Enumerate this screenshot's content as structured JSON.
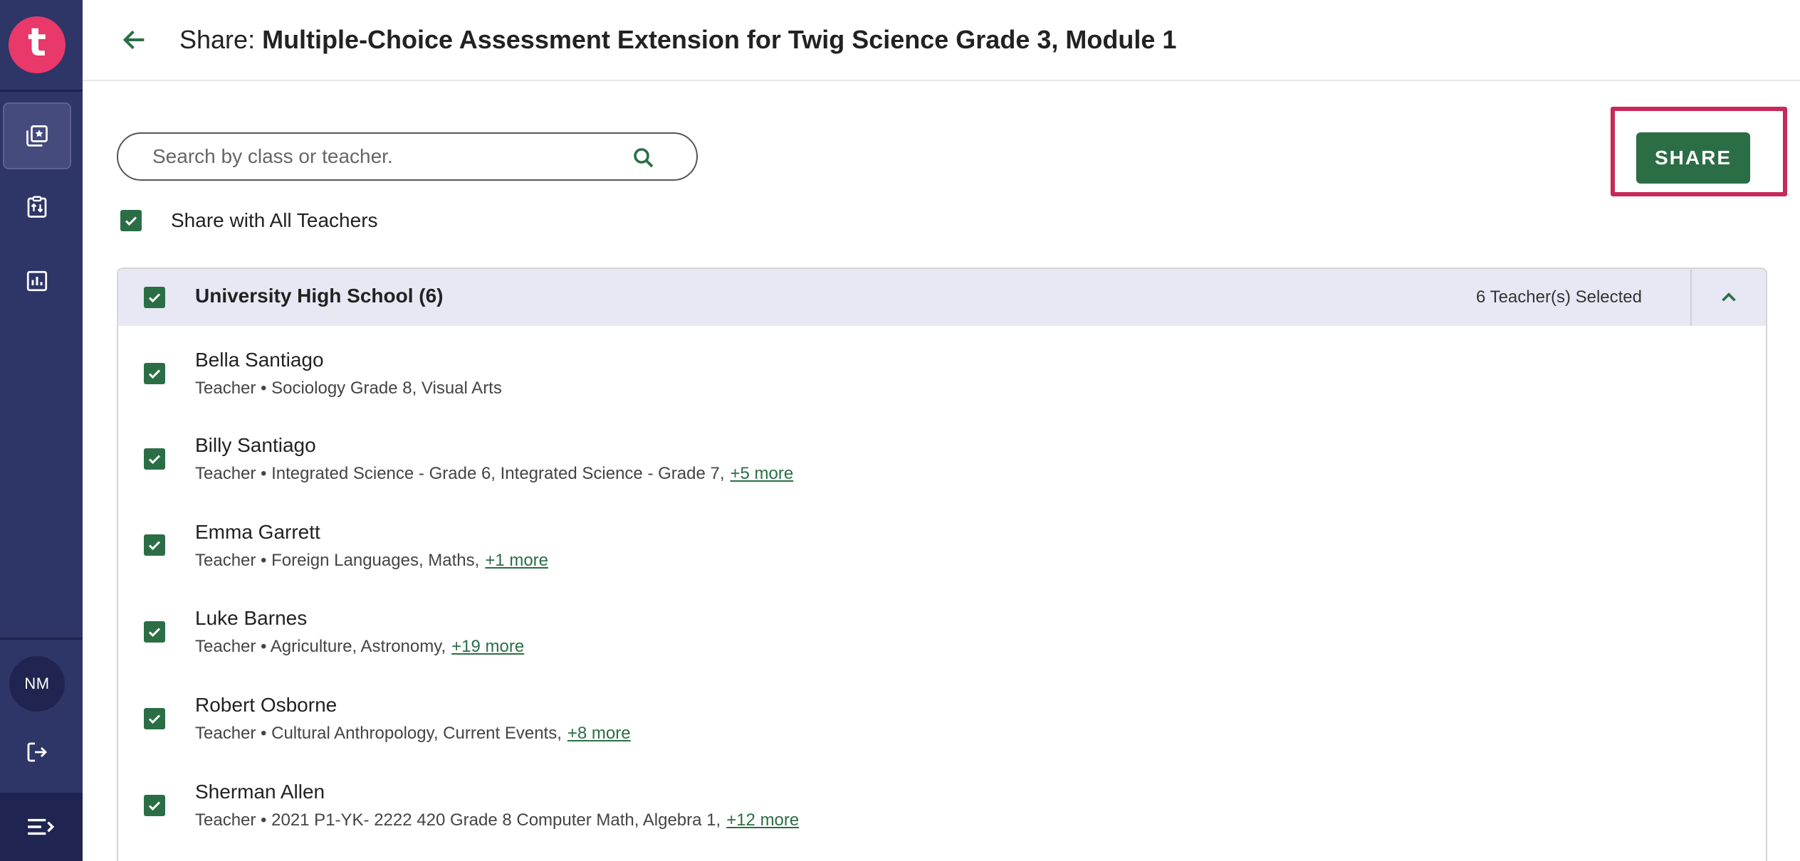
{
  "app": {
    "logo_letter": "t",
    "user_initials": "NM"
  },
  "header": {
    "title_prefix": "Share: ",
    "title_name": "Multiple-Choice Assessment Extension for Twig Science Grade 3, Module 1"
  },
  "search": {
    "placeholder": "Search by class or teacher.",
    "value": ""
  },
  "actions": {
    "share_label": "SHARE"
  },
  "share_all": {
    "label": "Share with All Teachers",
    "checked": true
  },
  "school": {
    "name": "University High School (6)",
    "selected_label": "6 Teacher(s) Selected",
    "teachers": [
      {
        "name": "Bella Santiago",
        "meta": "Teacher • Sociology Grade 8, Visual Arts",
        "more": ""
      },
      {
        "name": "Billy Santiago",
        "meta": "Teacher • Integrated Science - Grade 6, Integrated Science - Grade 7,",
        "more": "+5 more"
      },
      {
        "name": "Emma Garrett",
        "meta": "Teacher • Foreign Languages, Maths,",
        "more": "+1 more"
      },
      {
        "name": "Luke Barnes",
        "meta": "Teacher • Agriculture, Astronomy,",
        "more": "+19 more"
      },
      {
        "name": "Robert Osborne",
        "meta": "Teacher • Cultural Anthropology, Current Events,",
        "more": "+8 more"
      },
      {
        "name": "Sherman Allen",
        "meta": "Teacher • 2021 P1-YK- 2222 420 Grade 8 Computer Math, Algebra 1,",
        "more": "+12 more"
      }
    ]
  },
  "colors": {
    "sidebar": "#2e3567",
    "accent_green": "#2b6e46",
    "highlight": "#c8285a",
    "logo": "#e9386a"
  },
  "icons": {
    "sidebar": [
      "library-star-icon",
      "clipboard-sort-icon",
      "bar-chart-icon",
      "logout-icon",
      "menu-open-icon"
    ],
    "header": [
      "arrow-back-icon"
    ],
    "search": [
      "search-icon"
    ],
    "panel": [
      "chevron-up-icon"
    ]
  }
}
